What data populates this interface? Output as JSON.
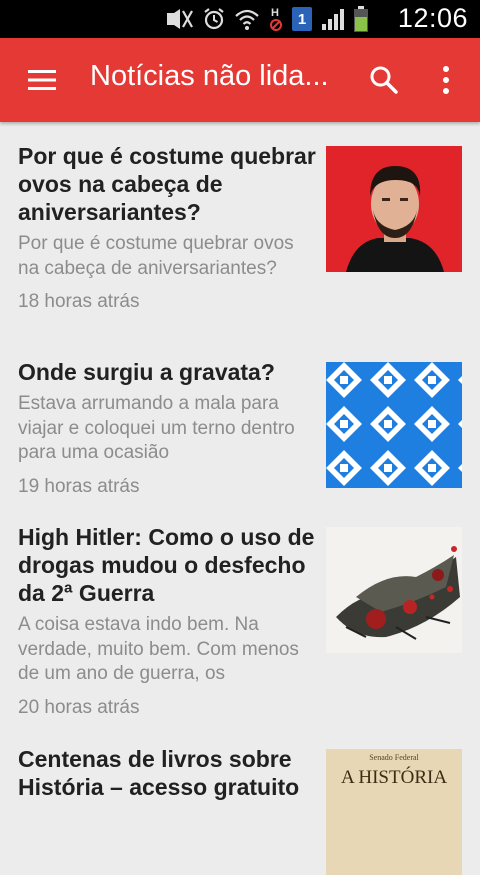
{
  "status_bar": {
    "time": "12:06",
    "battery_color": "#8bc34a",
    "notification_badge": "1",
    "icons": [
      "mute-icon",
      "alarm-icon",
      "wifi-icon",
      "h-data-icon",
      "notification-icon",
      "signal-icon",
      "battery-icon"
    ]
  },
  "toolbar": {
    "title": "Notícias não lida...",
    "color": "#e53935",
    "icons": [
      "menu-icon",
      "search-icon",
      "more-vert-icon"
    ]
  },
  "articles": [
    {
      "headline": "Por que é costume quebrar ovos na cabeça de aniversariantes?",
      "snippet": "Por que é costume quebrar ovos na cabeça de aniversariantes?",
      "time": "18 horas atrás"
    },
    {
      "headline": "Onde surgiu a gravata?",
      "snippet": "Estava arrumando a mala para viajar e coloquei um terno dentro para uma ocasião",
      "time": "19 horas atrás"
    },
    {
      "headline": "High Hitler: Como o uso de drogas mudou o desfecho da 2ª Guerra",
      "snippet": "A coisa estava indo bem. Na verdade, muito bem. Com menos de um ano de guerra, os",
      "time": "20 horas atrás"
    },
    {
      "headline": "Centenas de livros sobre História – acesso gratuito",
      "snippet": "",
      "time": "",
      "thumb_text_1": "Senado Federal",
      "thumb_text_2": "A HISTÓRIA"
    }
  ]
}
